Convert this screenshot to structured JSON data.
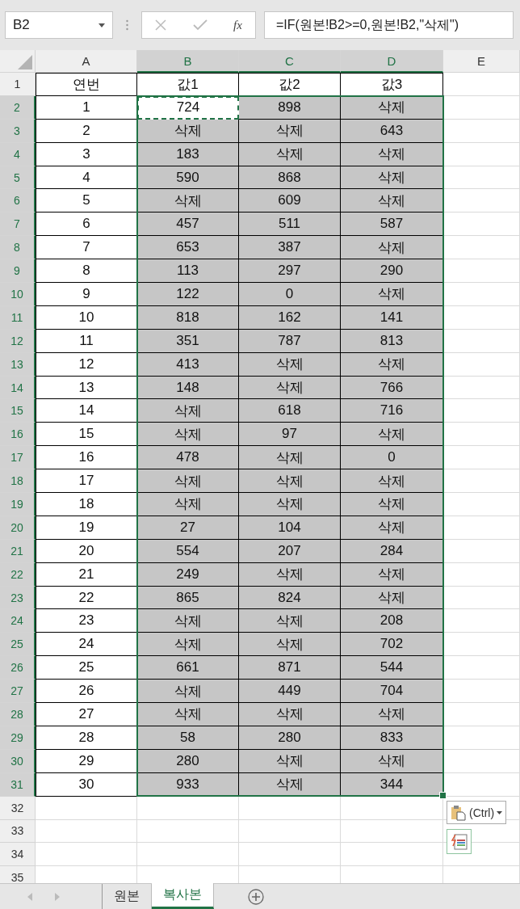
{
  "name_box": {
    "value": "B2"
  },
  "formula_bar": {
    "function_label": "fx",
    "formula": "=IF(원본!B2>=0,원본!B2,\"삭제\")"
  },
  "columns": [
    {
      "label": "A",
      "selected": false
    },
    {
      "label": "B",
      "selected": true
    },
    {
      "label": "C",
      "selected": true
    },
    {
      "label": "D",
      "selected": true
    },
    {
      "label": "E",
      "selected": false
    }
  ],
  "rows": [
    {
      "number": "1",
      "selected": false,
      "cells": [
        {
          "text": "연번",
          "selected": false,
          "active": false
        },
        {
          "text": "값1",
          "selected": false,
          "active": false
        },
        {
          "text": "값2",
          "selected": false,
          "active": false
        },
        {
          "text": "값3",
          "selected": false,
          "active": false
        }
      ]
    },
    {
      "number": "2",
      "selected": true,
      "cells": [
        {
          "text": "1",
          "selected": false,
          "active": false
        },
        {
          "text": "724",
          "selected": false,
          "active": true
        },
        {
          "text": "898",
          "selected": true,
          "active": false
        },
        {
          "text": "삭제",
          "selected": true,
          "active": false
        }
      ]
    },
    {
      "number": "3",
      "selected": true,
      "cells": [
        {
          "text": "2",
          "selected": false,
          "active": false
        },
        {
          "text": "삭제",
          "selected": true,
          "active": false
        },
        {
          "text": "삭제",
          "selected": true,
          "active": false
        },
        {
          "text": "643",
          "selected": true,
          "active": false
        }
      ]
    },
    {
      "number": "4",
      "selected": true,
      "cells": [
        {
          "text": "3",
          "selected": false,
          "active": false
        },
        {
          "text": "183",
          "selected": true,
          "active": false
        },
        {
          "text": "삭제",
          "selected": true,
          "active": false
        },
        {
          "text": "삭제",
          "selected": true,
          "active": false
        }
      ]
    },
    {
      "number": "5",
      "selected": true,
      "cells": [
        {
          "text": "4",
          "selected": false,
          "active": false
        },
        {
          "text": "590",
          "selected": true,
          "active": false
        },
        {
          "text": "868",
          "selected": true,
          "active": false
        },
        {
          "text": "삭제",
          "selected": true,
          "active": false
        }
      ]
    },
    {
      "number": "6",
      "selected": true,
      "cells": [
        {
          "text": "5",
          "selected": false,
          "active": false
        },
        {
          "text": "삭제",
          "selected": true,
          "active": false
        },
        {
          "text": "609",
          "selected": true,
          "active": false
        },
        {
          "text": "삭제",
          "selected": true,
          "active": false
        }
      ]
    },
    {
      "number": "7",
      "selected": true,
      "cells": [
        {
          "text": "6",
          "selected": false,
          "active": false
        },
        {
          "text": "457",
          "selected": true,
          "active": false
        },
        {
          "text": "511",
          "selected": true,
          "active": false
        },
        {
          "text": "587",
          "selected": true,
          "active": false
        }
      ]
    },
    {
      "number": "8",
      "selected": true,
      "cells": [
        {
          "text": "7",
          "selected": false,
          "active": false
        },
        {
          "text": "653",
          "selected": true,
          "active": false
        },
        {
          "text": "387",
          "selected": true,
          "active": false
        },
        {
          "text": "삭제",
          "selected": true,
          "active": false
        }
      ]
    },
    {
      "number": "9",
      "selected": true,
      "cells": [
        {
          "text": "8",
          "selected": false,
          "active": false
        },
        {
          "text": "113",
          "selected": true,
          "active": false
        },
        {
          "text": "297",
          "selected": true,
          "active": false
        },
        {
          "text": "290",
          "selected": true,
          "active": false
        }
      ]
    },
    {
      "number": "10",
      "selected": true,
      "cells": [
        {
          "text": "9",
          "selected": false,
          "active": false
        },
        {
          "text": "122",
          "selected": true,
          "active": false
        },
        {
          "text": "0",
          "selected": true,
          "active": false
        },
        {
          "text": "삭제",
          "selected": true,
          "active": false
        }
      ]
    },
    {
      "number": "11",
      "selected": true,
      "cells": [
        {
          "text": "10",
          "selected": false,
          "active": false
        },
        {
          "text": "818",
          "selected": true,
          "active": false
        },
        {
          "text": "162",
          "selected": true,
          "active": false
        },
        {
          "text": "141",
          "selected": true,
          "active": false
        }
      ]
    },
    {
      "number": "12",
      "selected": true,
      "cells": [
        {
          "text": "11",
          "selected": false,
          "active": false
        },
        {
          "text": "351",
          "selected": true,
          "active": false
        },
        {
          "text": "787",
          "selected": true,
          "active": false
        },
        {
          "text": "813",
          "selected": true,
          "active": false
        }
      ]
    },
    {
      "number": "13",
      "selected": true,
      "cells": [
        {
          "text": "12",
          "selected": false,
          "active": false
        },
        {
          "text": "413",
          "selected": true,
          "active": false
        },
        {
          "text": "삭제",
          "selected": true,
          "active": false
        },
        {
          "text": "삭제",
          "selected": true,
          "active": false
        }
      ]
    },
    {
      "number": "14",
      "selected": true,
      "cells": [
        {
          "text": "13",
          "selected": false,
          "active": false
        },
        {
          "text": "148",
          "selected": true,
          "active": false
        },
        {
          "text": "삭제",
          "selected": true,
          "active": false
        },
        {
          "text": "766",
          "selected": true,
          "active": false
        }
      ]
    },
    {
      "number": "15",
      "selected": true,
      "cells": [
        {
          "text": "14",
          "selected": false,
          "active": false
        },
        {
          "text": "삭제",
          "selected": true,
          "active": false
        },
        {
          "text": "618",
          "selected": true,
          "active": false
        },
        {
          "text": "716",
          "selected": true,
          "active": false
        }
      ]
    },
    {
      "number": "16",
      "selected": true,
      "cells": [
        {
          "text": "15",
          "selected": false,
          "active": false
        },
        {
          "text": "삭제",
          "selected": true,
          "active": false
        },
        {
          "text": "97",
          "selected": true,
          "active": false
        },
        {
          "text": "삭제",
          "selected": true,
          "active": false
        }
      ]
    },
    {
      "number": "17",
      "selected": true,
      "cells": [
        {
          "text": "16",
          "selected": false,
          "active": false
        },
        {
          "text": "478",
          "selected": true,
          "active": false
        },
        {
          "text": "삭제",
          "selected": true,
          "active": false
        },
        {
          "text": "0",
          "selected": true,
          "active": false
        }
      ]
    },
    {
      "number": "18",
      "selected": true,
      "cells": [
        {
          "text": "17",
          "selected": false,
          "active": false
        },
        {
          "text": "삭제",
          "selected": true,
          "active": false
        },
        {
          "text": "삭제",
          "selected": true,
          "active": false
        },
        {
          "text": "삭제",
          "selected": true,
          "active": false
        }
      ]
    },
    {
      "number": "19",
      "selected": true,
      "cells": [
        {
          "text": "18",
          "selected": false,
          "active": false
        },
        {
          "text": "삭제",
          "selected": true,
          "active": false
        },
        {
          "text": "삭제",
          "selected": true,
          "active": false
        },
        {
          "text": "삭제",
          "selected": true,
          "active": false
        }
      ]
    },
    {
      "number": "20",
      "selected": true,
      "cells": [
        {
          "text": "19",
          "selected": false,
          "active": false
        },
        {
          "text": "27",
          "selected": true,
          "active": false
        },
        {
          "text": "104",
          "selected": true,
          "active": false
        },
        {
          "text": "삭제",
          "selected": true,
          "active": false
        }
      ]
    },
    {
      "number": "21",
      "selected": true,
      "cells": [
        {
          "text": "20",
          "selected": false,
          "active": false
        },
        {
          "text": "554",
          "selected": true,
          "active": false
        },
        {
          "text": "207",
          "selected": true,
          "active": false
        },
        {
          "text": "284",
          "selected": true,
          "active": false
        }
      ]
    },
    {
      "number": "22",
      "selected": true,
      "cells": [
        {
          "text": "21",
          "selected": false,
          "active": false
        },
        {
          "text": "249",
          "selected": true,
          "active": false
        },
        {
          "text": "삭제",
          "selected": true,
          "active": false
        },
        {
          "text": "삭제",
          "selected": true,
          "active": false
        }
      ]
    },
    {
      "number": "23",
      "selected": true,
      "cells": [
        {
          "text": "22",
          "selected": false,
          "active": false
        },
        {
          "text": "865",
          "selected": true,
          "active": false
        },
        {
          "text": "824",
          "selected": true,
          "active": false
        },
        {
          "text": "삭제",
          "selected": true,
          "active": false
        }
      ]
    },
    {
      "number": "24",
      "selected": true,
      "cells": [
        {
          "text": "23",
          "selected": false,
          "active": false
        },
        {
          "text": "삭제",
          "selected": true,
          "active": false
        },
        {
          "text": "삭제",
          "selected": true,
          "active": false
        },
        {
          "text": "208",
          "selected": true,
          "active": false
        }
      ]
    },
    {
      "number": "25",
      "selected": true,
      "cells": [
        {
          "text": "24",
          "selected": false,
          "active": false
        },
        {
          "text": "삭제",
          "selected": true,
          "active": false
        },
        {
          "text": "삭제",
          "selected": true,
          "active": false
        },
        {
          "text": "702",
          "selected": true,
          "active": false
        }
      ]
    },
    {
      "number": "26",
      "selected": true,
      "cells": [
        {
          "text": "25",
          "selected": false,
          "active": false
        },
        {
          "text": "661",
          "selected": true,
          "active": false
        },
        {
          "text": "871",
          "selected": true,
          "active": false
        },
        {
          "text": "544",
          "selected": true,
          "active": false
        }
      ]
    },
    {
      "number": "27",
      "selected": true,
      "cells": [
        {
          "text": "26",
          "selected": false,
          "active": false
        },
        {
          "text": "삭제",
          "selected": true,
          "active": false
        },
        {
          "text": "449",
          "selected": true,
          "active": false
        },
        {
          "text": "704",
          "selected": true,
          "active": false
        }
      ]
    },
    {
      "number": "28",
      "selected": true,
      "cells": [
        {
          "text": "27",
          "selected": false,
          "active": false
        },
        {
          "text": "삭제",
          "selected": true,
          "active": false
        },
        {
          "text": "삭제",
          "selected": true,
          "active": false
        },
        {
          "text": "삭제",
          "selected": true,
          "active": false
        }
      ]
    },
    {
      "number": "29",
      "selected": true,
      "cells": [
        {
          "text": "28",
          "selected": false,
          "active": false
        },
        {
          "text": "58",
          "selected": true,
          "active": false
        },
        {
          "text": "280",
          "selected": true,
          "active": false
        },
        {
          "text": "833",
          "selected": true,
          "active": false
        }
      ]
    },
    {
      "number": "30",
      "selected": true,
      "cells": [
        {
          "text": "29",
          "selected": false,
          "active": false
        },
        {
          "text": "280",
          "selected": true,
          "active": false
        },
        {
          "text": "삭제",
          "selected": true,
          "active": false
        },
        {
          "text": "삭제",
          "selected": true,
          "active": false
        }
      ]
    },
    {
      "number": "31",
      "selected": true,
      "cells": [
        {
          "text": "30",
          "selected": false,
          "active": false
        },
        {
          "text": "933",
          "selected": true,
          "active": false
        },
        {
          "text": "삭제",
          "selected": true,
          "active": false
        },
        {
          "text": "344",
          "selected": true,
          "active": false
        }
      ]
    },
    {
      "number": "32",
      "selected": false,
      "cells": []
    },
    {
      "number": "33",
      "selected": false,
      "cells": []
    },
    {
      "number": "34",
      "selected": false,
      "cells": []
    },
    {
      "number": "35",
      "selected": false,
      "cells": []
    }
  ],
  "paste_options": {
    "label": "(Ctrl)"
  },
  "sheet_tabs": [
    {
      "label": "원본",
      "selected": false
    },
    {
      "label": "복사본",
      "selected": true
    }
  ]
}
